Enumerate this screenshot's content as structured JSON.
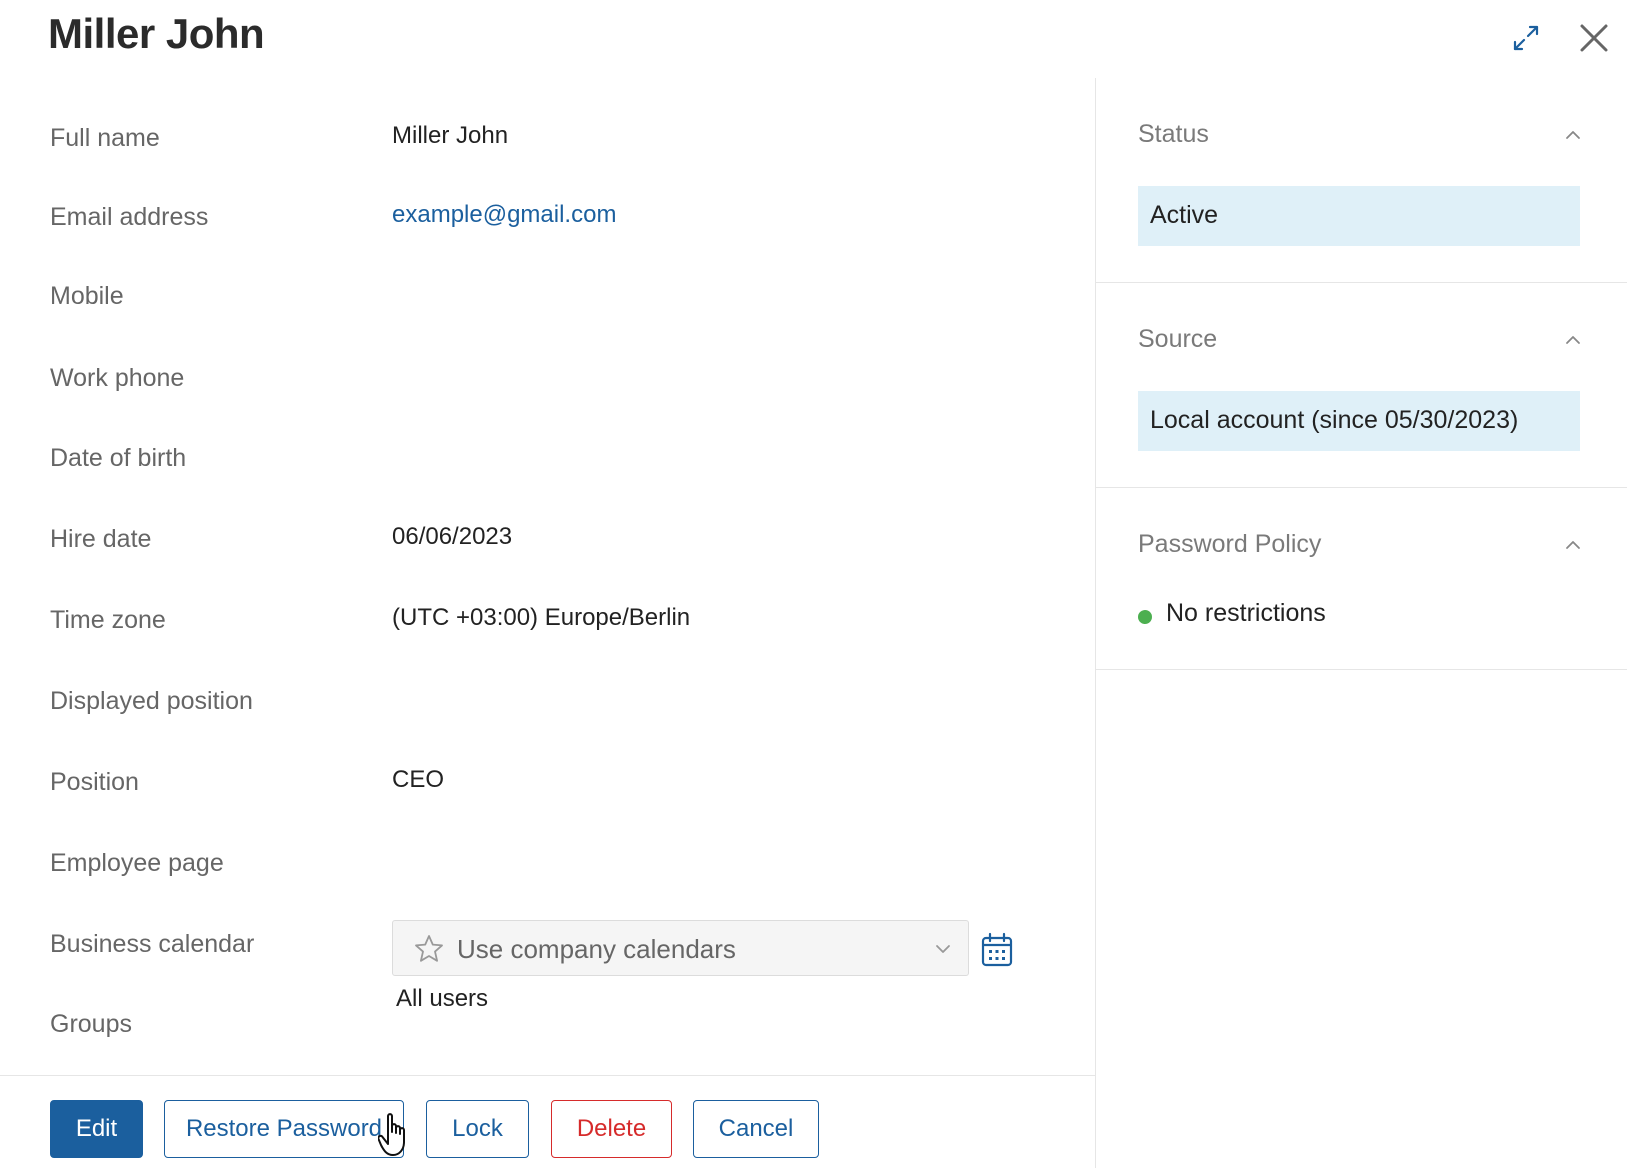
{
  "header": {
    "title": "Miller John"
  },
  "fields": [
    {
      "label": "Full name",
      "value": "Miller John"
    },
    {
      "label": "Email address",
      "value": "example@gmail.com"
    },
    {
      "label": "Mobile",
      "value": ""
    },
    {
      "label": "Work phone",
      "value": ""
    },
    {
      "label": "Date of birth",
      "value": ""
    },
    {
      "label": "Hire date",
      "value": "06/06/2023"
    },
    {
      "label": "Time zone",
      "value": "(UTC +03:00) Europe/Berlin"
    },
    {
      "label": "Displayed position",
      "value": ""
    },
    {
      "label": "Position",
      "value": "CEO"
    },
    {
      "label": "Employee page",
      "value": ""
    },
    {
      "label": "Business calendar",
      "value": "Use company calendars"
    },
    {
      "label": "Groups",
      "value": "All users"
    }
  ],
  "actions": {
    "edit": "Edit",
    "restore_password": "Restore Password",
    "lock": "Lock",
    "delete": "Delete",
    "cancel": "Cancel"
  },
  "sidebar": {
    "status": {
      "title": "Status",
      "value": "Active"
    },
    "source": {
      "title": "Source",
      "value": "Local account (since 05/30/2023)"
    },
    "password_policy": {
      "title": "Password Policy",
      "value": "No restrictions"
    }
  },
  "colors": {
    "accent": "#1b5f9e",
    "danger": "#d62b2b",
    "highlight": "#dff0f8",
    "ok": "#4caf50"
  }
}
